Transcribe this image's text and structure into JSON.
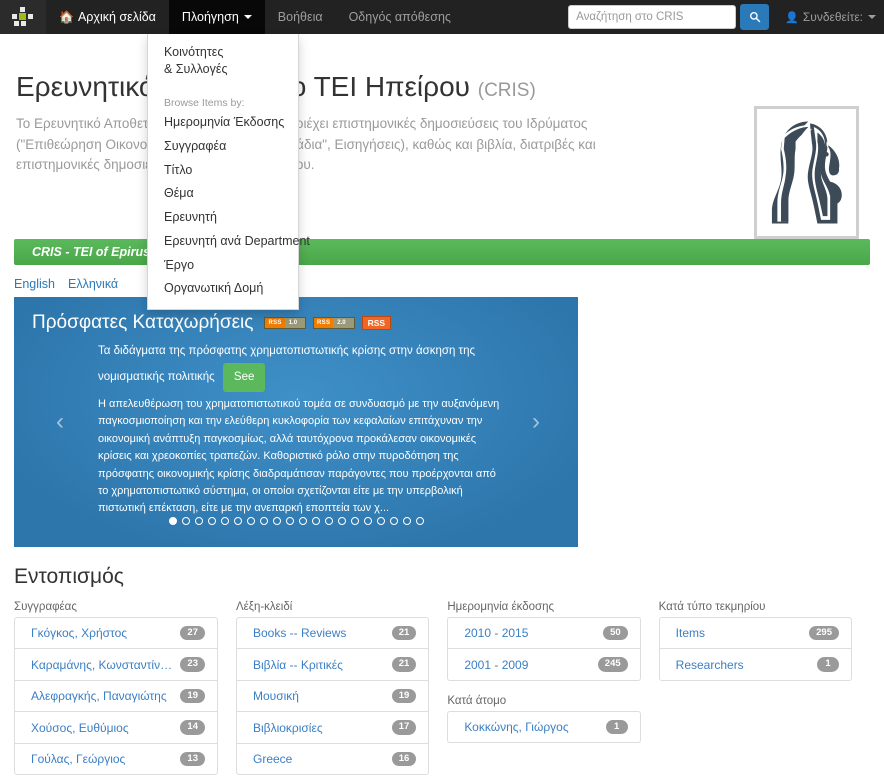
{
  "navbar": {
    "logo_icon": "dspace-dots-logo",
    "items": [
      {
        "label": "Αρχική σελίδα",
        "icon": "home-icon",
        "state": "home"
      },
      {
        "label": "Πλοήγηση",
        "icon": "caret-down-icon",
        "state": "active"
      },
      {
        "label": "Βοήθεια",
        "state": "normal"
      },
      {
        "label": "Οδηγός απόθεσης",
        "state": "normal"
      }
    ],
    "search": {
      "placeholder": "Αναζήτηση στο CRIS",
      "value": "",
      "button_icon": "search-icon"
    },
    "login": {
      "label": "Συνδεθείτε:",
      "icon": "user-icon",
      "caret": "caret-down-icon"
    }
  },
  "dropdown": {
    "open": true,
    "first_item_line1": "Κοινότητες",
    "first_item_line2": "& Συλλογές",
    "section_header": "Browse Items by:",
    "items": [
      "Ημερομηνία Έκδοσης",
      "Συγγραφέα",
      "Τίτλο",
      "Θέμα",
      "Ερευνητή",
      "Ερευνητή ανά Department",
      "Έργο",
      "Οργανωτική Δομή"
    ]
  },
  "hero": {
    "title": "Ερευνητικό Αποθετήριο ΤΕΙ Ηπείρου",
    "title_suffix": "(CRIS)",
    "description": "Το Ερευνητικό Αποθετήριο του ΤΕΙ Ηπείρου περιέχει επιστημονικές δημοσιεύσεις του Ιδρύματος (\"Επιθεώρηση Οικονομικών Επιστημών\", \"Τετράδια\", Εισηγήσεις), καθώς και βιβλία, διατριβές και επιστημονικές δημοσιεύσεις του προσωπικού του.",
    "logo_icon": "classical-profile-bust-logo"
  },
  "green_bar": {
    "text": "CRIS - TEI of Epirus"
  },
  "languages": [
    {
      "label": "English"
    },
    {
      "label": "Ελληνικά"
    }
  ],
  "carousel": {
    "title": "Πρόσφατες Καταχωρήσεις",
    "rss": [
      {
        "left": "RSS",
        "right": "1.0",
        "style": "pill"
      },
      {
        "left": "RSS",
        "right": "2.0",
        "style": "pill"
      },
      {
        "left": "RSS",
        "style": "solid"
      }
    ],
    "item_title": "Τα διδάγματα της πρόσφατης χρηματοπιστωτικής κρίσης στην άσκηση της νομισματικής πολιτικής",
    "see_button": "See",
    "abstract": "Η απελευθέρωση του χρηματοπιστωτικού τομέα σε συνδυασμό με την αυξανόμενη παγκοσμιοποίηση και την ελεύθερη κυκλοφορία των κεφαλαίων επιτάχυναν την οικονομική ανάπτυξη παγκοσμίως, αλλά ταυτόχρονα προκάλεσαν οικονομικές κρίσεις και χρεοκοπίες τραπεζών. Καθοριστικό ρόλο στην πυροδότηση της πρόσφατης οικονομικής κρίσης διαδραμάτισαν παράγοντες που προέρχονται από το χρηματοπιστωτικό σύστημα, οι οποίοι σχετίζονται είτε με την υπερβολική πιστωτική επέκταση, είτε με την ανεπαρκή εποπτεία των χ...",
    "prev_icon": "chevron-left-icon",
    "next_icon": "chevron-right-icon",
    "dot_count": 20,
    "active_dot": 0
  },
  "discovery": {
    "title": "Εντοπισμός",
    "columns": [
      {
        "blocks": [
          {
            "label": "Συγγραφέας",
            "rows": [
              {
                "name": "Γκόγκος, Χρήστος",
                "count": "27"
              },
              {
                "name": "Καραμάνης, Κωνσταντίνος",
                "count": "23"
              },
              {
                "name": "Αλεφραγκής, Παναγιώτης",
                "count": "19"
              },
              {
                "name": "Χούσος, Ευθύμιος",
                "count": "14"
              },
              {
                "name": "Γούλας, Γεώργιος",
                "count": "13"
              }
            ]
          }
        ]
      },
      {
        "blocks": [
          {
            "label": "Λέξη-κλειδί",
            "rows": [
              {
                "name": "Books -- Reviews",
                "count": "21"
              },
              {
                "name": "Βιβλία -- Κριτικές",
                "count": "21"
              },
              {
                "name": "Μουσική",
                "count": "19"
              },
              {
                "name": "Βιβλιοκρισίες",
                "count": "17"
              },
              {
                "name": "Greece",
                "count": "16"
              }
            ]
          }
        ]
      },
      {
        "blocks": [
          {
            "label": "Ημερομηνία έκδοσης",
            "rows": [
              {
                "name": "2010 - 2015",
                "count": "50"
              },
              {
                "name": "2001 - 2009",
                "count": "245"
              }
            ]
          },
          {
            "label": "Κατά άτομο",
            "rows": [
              {
                "name": "Κοκκώνης, Γιώργος",
                "count": "1"
              }
            ]
          }
        ]
      },
      {
        "blocks": [
          {
            "label": "Κατά τύπο τεκμηρίου",
            "rows": [
              {
                "name": "Items",
                "count": "295"
              },
              {
                "name": "Researchers",
                "count": "1"
              }
            ]
          }
        ]
      }
    ]
  },
  "colors": {
    "navbar_bg": "#222222",
    "accent_blue": "#2a7ab9",
    "green": "#5cb85c",
    "link_blue": "#3b7fc4",
    "carousel_blue": "#2d76ac",
    "rss_orange": "#f26522"
  }
}
